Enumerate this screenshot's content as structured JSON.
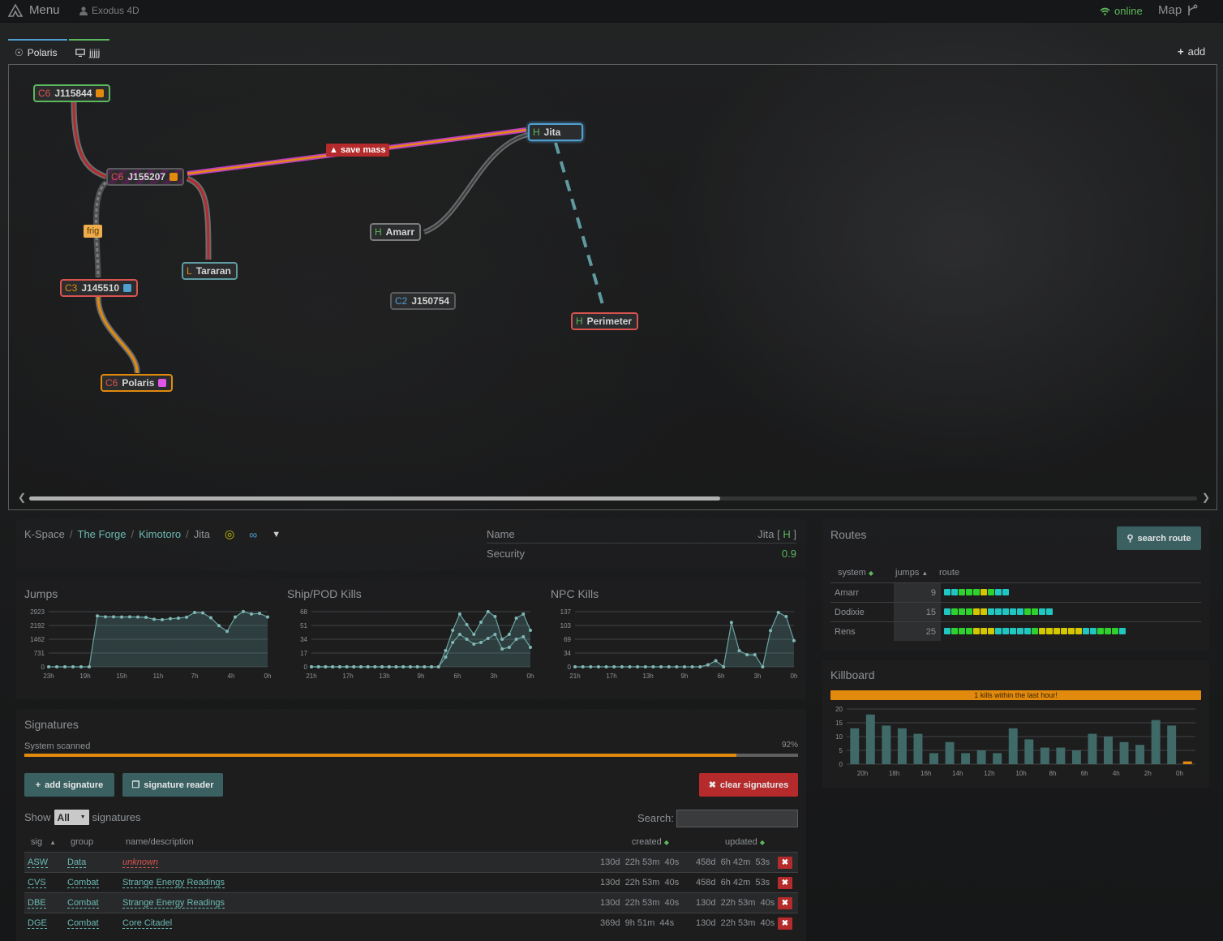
{
  "topbar": {
    "menu_label": "Menu",
    "character": "Exodus 4D",
    "status": "online",
    "map_label": "Map"
  },
  "map_tabs": [
    {
      "label": "Polaris",
      "color": "#4f9fd0"
    },
    {
      "label": "jjjjj",
      "color": "#5cb85c"
    }
  ],
  "add_map_label": "add",
  "systems": [
    {
      "class": "C6",
      "name": "J115844",
      "class_color": "#d9534f",
      "border": "#5cb85c",
      "marker": "#e28a0d"
    },
    {
      "class": "C6",
      "name": "J155207",
      "class_color": "#d9534f",
      "border": "#5a5c5e",
      "marker": "#e28a0d"
    },
    {
      "class": "C3",
      "name": "J145510",
      "class_color": "#e28a0d",
      "border": "#d9534f",
      "marker": "#4f9fd0"
    },
    {
      "class": "C6",
      "name": "Polaris",
      "class_color": "#d9534f",
      "border": "#e28a0d",
      "marker": "#e055e8"
    },
    {
      "class": "L",
      "name": "Tararan",
      "class_color": "#e28a0d",
      "border": "#5e9aa0",
      "marker": ""
    },
    {
      "class": "H",
      "name": "Amarr",
      "class_color": "#5cb85c",
      "border": "#7a7c7e",
      "marker": ""
    },
    {
      "class": "C2",
      "name": "J150754",
      "class_color": "#4f9fd0",
      "border": "#5a5c5e",
      "marker": ""
    },
    {
      "class": "H",
      "name": "Jita",
      "class_color": "#5cb85c",
      "border": "#4f9fd0",
      "marker": ""
    },
    {
      "class": "H",
      "name": "Perimeter",
      "class_color": "#5cb85c",
      "border": "#d9534f",
      "marker": ""
    }
  ],
  "connection_labels": {
    "save_mass": "save mass",
    "frig": "frig"
  },
  "breadcrumb": [
    "K-Space",
    "The Forge",
    "Kimotoro",
    "Jita"
  ],
  "sysinfo": {
    "name_label": "Name",
    "name_value": "Jita",
    "name_class": "H",
    "security_label": "Security",
    "security_value": "0.9"
  },
  "graphs": [
    {
      "title": "Jumps",
      "yticks": [
        "2923",
        "2192",
        "1462",
        "731",
        "0"
      ],
      "xticks": [
        "23h",
        "19h",
        "15h",
        "11h",
        "7h",
        "4h",
        "0h"
      ],
      "ymax": 2923,
      "series": [
        [
          0,
          0,
          0,
          0,
          0,
          0,
          2700,
          2650,
          2650,
          2640,
          2650,
          2640,
          2620,
          2520,
          2500,
          2550,
          2580,
          2630,
          2880,
          2860,
          2600,
          2180,
          1880,
          2640,
          2930,
          2800,
          2830,
          2640
        ]
      ]
    },
    {
      "title": "Ship/POD Kills",
      "yticks": [
        "68",
        "51",
        "34",
        "17",
        "0"
      ],
      "xticks": [
        "21h",
        "17h",
        "13h",
        "9h",
        "6h",
        "3h",
        "0h"
      ],
      "ymax": 68,
      "series": [
        [
          0,
          0,
          0,
          0,
          0,
          0,
          0,
          0,
          0,
          0,
          0,
          0,
          0,
          0,
          0,
          0,
          0,
          0,
          0,
          20,
          45,
          65,
          52,
          40,
          55,
          68,
          62,
          34,
          40,
          60,
          65,
          45
        ],
        [
          0,
          0,
          0,
          0,
          0,
          0,
          0,
          0,
          0,
          0,
          0,
          0,
          0,
          0,
          0,
          0,
          0,
          0,
          0,
          12,
          30,
          40,
          34,
          28,
          30,
          35,
          40,
          22,
          24,
          34,
          37,
          24
        ]
      ]
    },
    {
      "title": "NPC Kills",
      "yticks": [
        "137",
        "103",
        "69",
        "34",
        "0"
      ],
      "xticks": [
        "21h",
        "17h",
        "13h",
        "9h",
        "6h",
        "3h",
        "0h"
      ],
      "ymax": 137,
      "series": [
        [
          0,
          0,
          0,
          0,
          0,
          0,
          0,
          0,
          0,
          0,
          0,
          0,
          0,
          0,
          0,
          0,
          0,
          5,
          15,
          0,
          110,
          40,
          30,
          30,
          0,
          90,
          135,
          125,
          65
        ]
      ]
    }
  ],
  "routes": {
    "title": "Routes",
    "search_label": "search route",
    "headers": [
      "system",
      "jumps",
      "route"
    ],
    "rows": [
      {
        "system": "Amarr",
        "jumps": "9",
        "dots": [
          "#22c6c0",
          "#22c6c0",
          "#2ed12e",
          "#2ed12e",
          "#2ed12e",
          "#d4c600",
          "#2ed12e",
          "#22c6c0",
          "#22c6c0"
        ]
      },
      {
        "system": "Dodixie",
        "jumps": "15",
        "dots": [
          "#22c6c0",
          "#2ed12e",
          "#2ed12e",
          "#2ed12e",
          "#d4c600",
          "#d4c600",
          "#22c6c0",
          "#22c6c0",
          "#22c6c0",
          "#22c6c0",
          "#22c6c0",
          "#2ed12e",
          "#2ed12e",
          "#22c6c0",
          "#22c6c0"
        ]
      },
      {
        "system": "Rens",
        "jumps": "25",
        "dots": [
          "#22c6c0",
          "#2ed12e",
          "#2ed12e",
          "#2ed12e",
          "#d4c600",
          "#d4c600",
          "#d4c600",
          "#22c6c0",
          "#22c6c0",
          "#22c6c0",
          "#22c6c0",
          "#22c6c0",
          "#2ed12e",
          "#d4c600",
          "#d4c600",
          "#d4c600",
          "#d4c600",
          "#d4c600",
          "#d4c600",
          "#22c6c0",
          "#22c6c0",
          "#2ed12e",
          "#2ed12e",
          "#2ed12e",
          "#22c6c0"
        ]
      }
    ]
  },
  "killboard": {
    "title": "Killboard",
    "notice": "1 kills within the last hour!",
    "yticks": [
      "20",
      "15",
      "10",
      "5",
      "0"
    ],
    "xticks": [
      "20h",
      "18h",
      "16h",
      "14h",
      "12h",
      "10h",
      "8h",
      "6h",
      "4h",
      "2h",
      "0h"
    ],
    "ymax": 20,
    "values": [
      13,
      18,
      14,
      13,
      11,
      4,
      8,
      4,
      5,
      4,
      13,
      9,
      6,
      6,
      5,
      11,
      10,
      8,
      7,
      16,
      14,
      1
    ]
  },
  "signatures": {
    "title": "Signatures",
    "scan_label": "System scanned",
    "scan_percent": "92%",
    "scan_fraction": 0.92,
    "add_label": "add signature",
    "reader_label": "signature reader",
    "clear_label": "clear signatures",
    "show_label": "Show",
    "show_value": "All",
    "show_suffix": "signatures",
    "search_label": "Search:",
    "headers": [
      "sig",
      "group",
      "name/description",
      "created",
      "updated"
    ],
    "rows": [
      {
        "sig": "ASW",
        "group": "Data",
        "name": "unknown",
        "unknown": true,
        "created": "130d  22h 53m  40s",
        "updated": "458d  6h 42m  53s"
      },
      {
        "sig": "CVS",
        "group": "Combat",
        "name": "Strange Energy Readings",
        "unknown": false,
        "created": "130d  22h 53m  40s",
        "updated": "458d  6h 42m  53s"
      },
      {
        "sig": "DBE",
        "group": "Combat",
        "name": "Strange Energy Readings",
        "unknown": false,
        "created": "130d  22h 53m  40s",
        "updated": "130d  22h 53m  40s"
      },
      {
        "sig": "DGE",
        "group": "Combat",
        "name": "Core Citadel",
        "unknown": false,
        "created": "369d  9h 51m  44s",
        "updated": "130d  22h 53m  40s"
      }
    ]
  }
}
